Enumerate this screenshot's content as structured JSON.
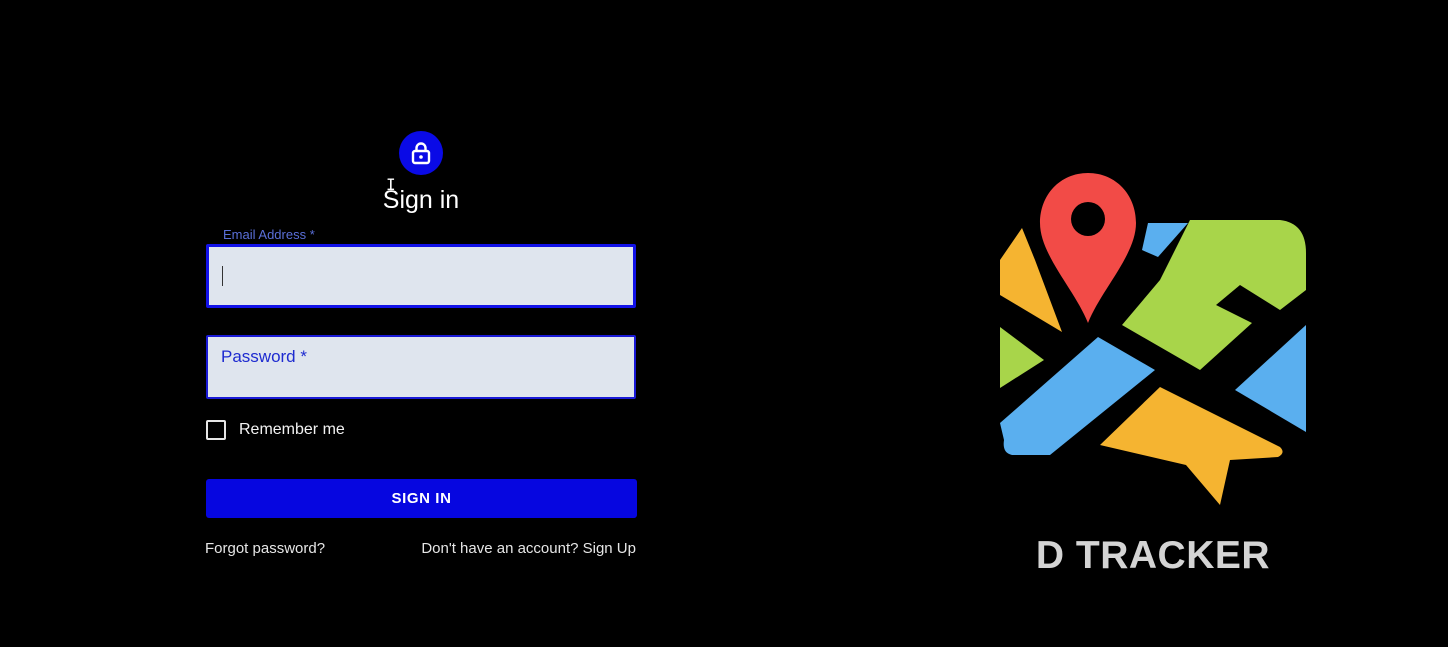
{
  "form": {
    "title": "Sign in",
    "email": {
      "label": "Email Address *",
      "value": ""
    },
    "password": {
      "label": "Password *",
      "value": ""
    },
    "remember_me": {
      "label": "Remember me",
      "checked": false
    },
    "submit_label": "SIGN IN",
    "forgot_password_link": "Forgot password?",
    "signup_link": "Don't have an account? Sign Up"
  },
  "brand": {
    "name": "D TRACKER",
    "logo_icon": "map-pin-logo-icon"
  },
  "colors": {
    "background": "#000000",
    "primary": "#0606e0",
    "field_background": "#dfe5ee",
    "brand_text": "#d4d4d4",
    "logo_red": "#f24b47",
    "logo_yellow": "#f5b431",
    "logo_green": "#a8d54a",
    "logo_blue": "#5aafef"
  }
}
